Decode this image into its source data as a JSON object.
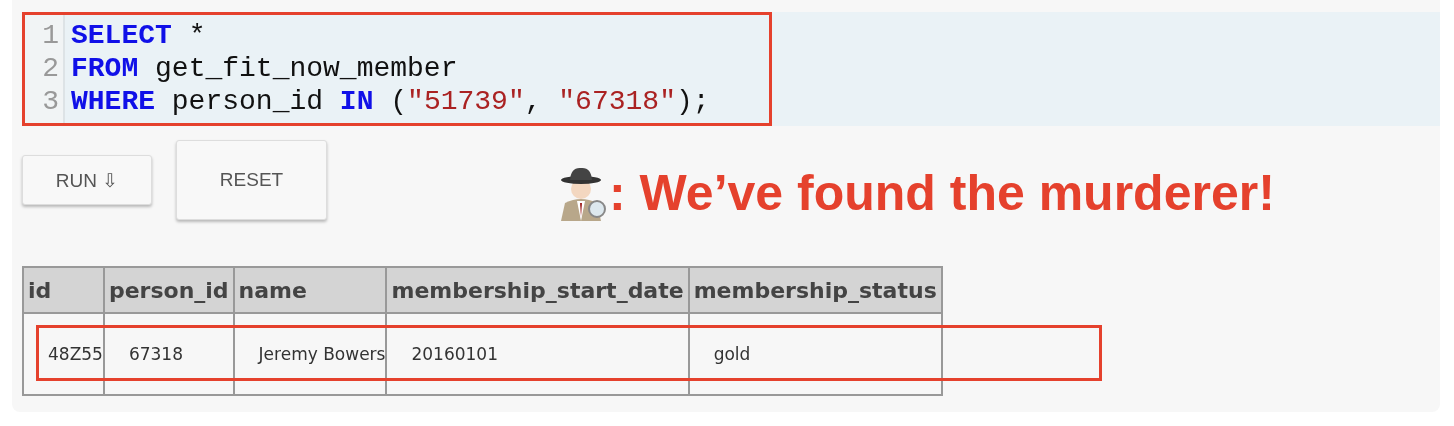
{
  "editor": {
    "highlighted": true,
    "lines": [
      {
        "number": "1",
        "tokens": [
          {
            "kind": "keyword",
            "text": "SELECT"
          },
          {
            "kind": "plain",
            "text": " *"
          }
        ]
      },
      {
        "number": "2",
        "tokens": [
          {
            "kind": "keyword",
            "text": "FROM"
          },
          {
            "kind": "plain",
            "text": " get_fit_now_member"
          }
        ]
      },
      {
        "number": "3",
        "tokens": [
          {
            "kind": "keyword",
            "text": "WHERE"
          },
          {
            "kind": "plain",
            "text": " person_id "
          },
          {
            "kind": "keyword",
            "text": "IN"
          },
          {
            "kind": "plain",
            "text": " ("
          },
          {
            "kind": "string",
            "text": "\"51739\""
          },
          {
            "kind": "plain",
            "text": ", "
          },
          {
            "kind": "string",
            "text": "\"67318\""
          },
          {
            "kind": "plain",
            "text": ");"
          }
        ]
      }
    ]
  },
  "buttons": [
    {
      "label": "RUN ⇩",
      "kind": "small"
    },
    {
      "label": "RESET",
      "kind": "large"
    }
  ],
  "message": ": We’ve found the murderer!",
  "table": {
    "columns": [
      "id",
      "person_id",
      "name",
      "membership_start_date",
      "membership_status"
    ],
    "rows": [
      {
        "highlighted": true,
        "cells": [
          "48Z55",
          "67318",
          "Jeremy Bowers",
          "20160101",
          "gold"
        ]
      }
    ]
  }
}
